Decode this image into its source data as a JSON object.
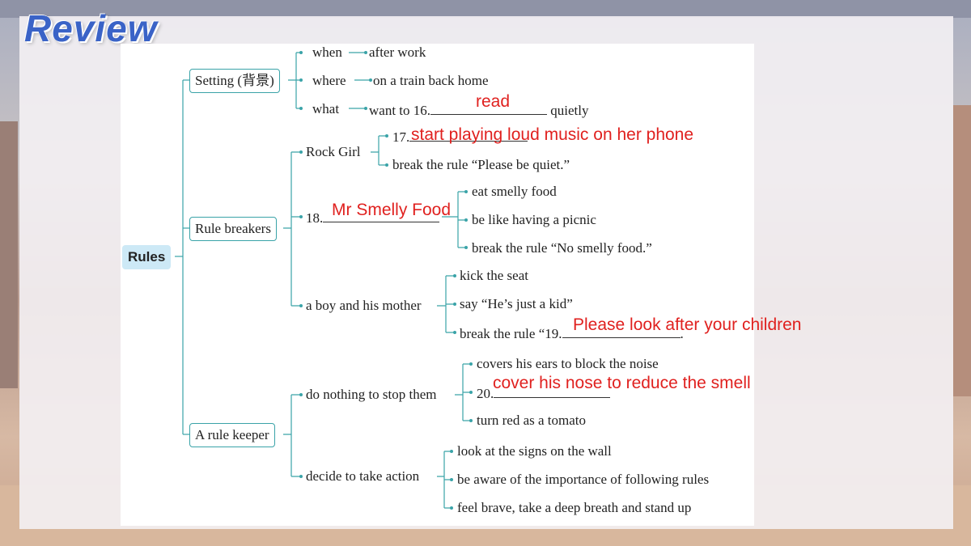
{
  "slide": {
    "title": "Review",
    "accent_color": "#3a63c7",
    "answer_color": "#e0211f",
    "line_color": "#3aa3a8"
  },
  "diagram": {
    "root": "Rules",
    "setting": {
      "label": "Setting (背景)",
      "when": "when",
      "when_value": "after work",
      "where": "where",
      "where_value": "on a train back home",
      "what": "what",
      "what_value_prefix": "want to 16.",
      "what_value_suffix": "quietly"
    },
    "rule_breakers": {
      "label": "Rule breakers",
      "rock_girl": {
        "label": "Rock Girl",
        "item1_number": "17.",
        "item2": "break the rule “Please be quiet.”"
      },
      "item18": {
        "number": "18.",
        "items": [
          "eat smelly food",
          "be like having a picnic",
          "break the rule “No smelly food.”"
        ]
      },
      "boy": {
        "label": "a boy and his mother",
        "items": [
          "kick the seat",
          "say “He’s just a kid”"
        ],
        "item3_prefix": "break the rule “19.",
        "item3_suffix": "."
      }
    },
    "rule_keeper": {
      "label": "A rule keeper",
      "nothing": {
        "label": "do nothing to stop them",
        "item1": "covers his ears to block the noise",
        "item2_number": "20.",
        "item3": "turn red as a tomato"
      },
      "action": {
        "label": "decide to take action",
        "items": [
          "look at the signs on the wall",
          "be aware of the importance of following rules",
          "feel brave, take a deep breath and stand up"
        ]
      }
    }
  },
  "answers": {
    "a16": "read",
    "a17": "start playing loud music on her phone",
    "a18": "Mr Smelly Food",
    "a19": "Please look after your children",
    "a20": "cover his nose to reduce the smell"
  }
}
